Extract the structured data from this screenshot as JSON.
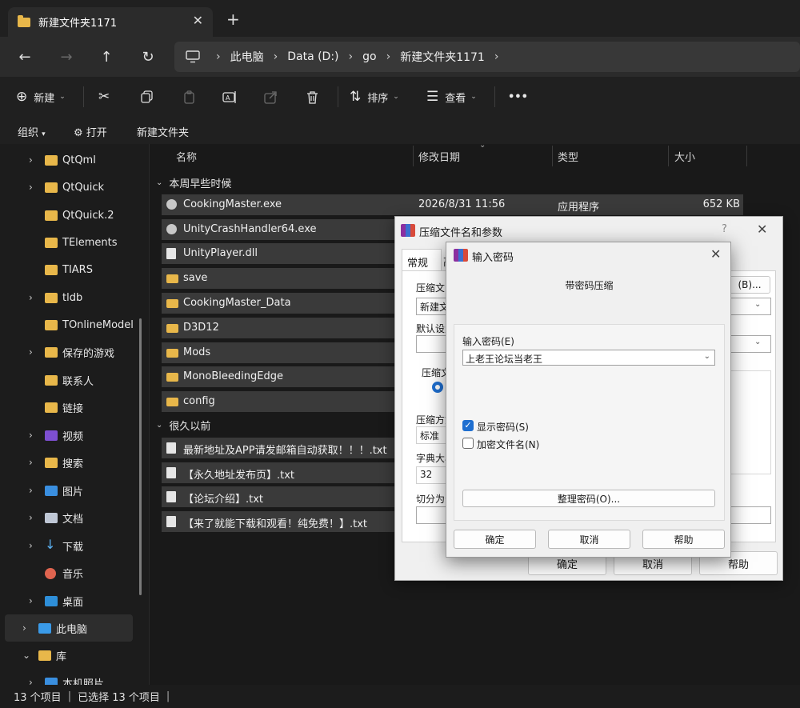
{
  "window": {
    "tab_title": "新建文件夹1171",
    "tab_close": "✕",
    "new_tab": "+"
  },
  "nav": {
    "back": "←",
    "forward": "→",
    "up": "↑",
    "refresh": "↻",
    "breadcrumb": [
      "此电脑",
      "Data (D:)",
      "go",
      "新建文件夹1171"
    ]
  },
  "commandbar": {
    "new_label": "新建",
    "sort_label": "排序",
    "view_label": "查看",
    "more": "•••"
  },
  "subbar": {
    "organize": "组织",
    "open": "打开",
    "new_folder": "新建文件夹"
  },
  "sidebar": {
    "items": [
      {
        "label": "QtQml",
        "icon": "folder-icon",
        "arrow": true
      },
      {
        "label": "QtQuick",
        "icon": "folder-icon",
        "arrow": true
      },
      {
        "label": "QtQuick.2",
        "icon": "folder-icon",
        "arrow": false
      },
      {
        "label": "TElements",
        "icon": "folder-icon",
        "arrow": false
      },
      {
        "label": "TIARS",
        "icon": "folder-icon",
        "arrow": false
      },
      {
        "label": "tldb",
        "icon": "folder-icon",
        "arrow": true
      },
      {
        "label": "TOnlineModel",
        "icon": "folder-icon",
        "arrow": false
      },
      {
        "label": "保存的游戏",
        "icon": "folder-icon",
        "arrow": true
      },
      {
        "label": "联系人",
        "icon": "folder-icon",
        "arrow": false
      },
      {
        "label": "链接",
        "icon": "folder-icon",
        "arrow": false
      },
      {
        "label": "视频",
        "icon": "video-icon",
        "arrow": true
      },
      {
        "label": "搜索",
        "icon": "folder-icon",
        "arrow": true
      },
      {
        "label": "图片",
        "icon": "picture-icon",
        "arrow": true
      },
      {
        "label": "文档",
        "icon": "document-icon",
        "arrow": true
      },
      {
        "label": "下载",
        "icon": "download-icon",
        "arrow": true
      },
      {
        "label": "音乐",
        "icon": "music-icon",
        "arrow": false
      },
      {
        "label": "桌面",
        "icon": "desktop-icon",
        "arrow": true
      },
      {
        "label": "此电脑",
        "icon": "pc-icon",
        "arrow": true
      },
      {
        "label": "库",
        "icon": "folder-icon",
        "arrow": true
      },
      {
        "label": "本机照片",
        "icon": "picture-icon",
        "arrow": true
      }
    ]
  },
  "filelist": {
    "columns": {
      "name": "名称",
      "date": "修改日期",
      "type": "类型",
      "size": "大小"
    },
    "group_recent": "本周早些时候",
    "group_old": "很久以前",
    "recent_rows": [
      {
        "name": "CookingMaster.exe",
        "date": "2026/8/31 11:56",
        "type": "应用程序",
        "size": "652 KB",
        "icon": "exe-icon"
      },
      {
        "name": "UnityCrashHandler64.exe",
        "icon": "exe-icon"
      },
      {
        "name": "UnityPlayer.dll",
        "icon": "dll-icon"
      },
      {
        "name": "save",
        "icon": "folder-icon"
      },
      {
        "name": "CookingMaster_Data",
        "icon": "folder-icon"
      },
      {
        "name": "D3D12",
        "icon": "folder-icon"
      },
      {
        "name": "Mods",
        "icon": "folder-icon"
      },
      {
        "name": "MonoBleedingEdge",
        "icon": "folder-icon"
      },
      {
        "name": "config",
        "icon": "folder-icon"
      }
    ],
    "old_rows": [
      {
        "name": "最新地址及APP请发邮箱自动获取！！！.txt",
        "icon": "text-file-icon"
      },
      {
        "name": "【永久地址发布页】.txt",
        "icon": "text-file-icon"
      },
      {
        "name": "【论坛介绍】.txt",
        "icon": "text-file-icon"
      },
      {
        "name": "【来了就能下载和观看！纯免费！】.txt",
        "icon": "text-file-icon"
      }
    ]
  },
  "status": {
    "count": "13 个项目",
    "selected": "已选择 13 个项目"
  },
  "compress_dialog": {
    "title": "压缩文件名和参数",
    "help_glyph": "?",
    "close_glyph": "✕",
    "tab_general": "常规",
    "tab_advanced": "高",
    "label_archive": "压缩文",
    "archive_value": "新建文",
    "browse_suffix": "(B)...",
    "label_default": "默认设置",
    "label_format": "压缩文",
    "label_method": "压缩方式",
    "method_value": "标准",
    "label_dict": "字典大小",
    "dict_value": "32",
    "label_split": "切分为分",
    "ok": "确定",
    "cancel": "取消",
    "help": "帮助"
  },
  "password_dialog": {
    "title": "输入密码",
    "close_glyph": "✕",
    "heading": "带密码压缩",
    "password_label": "输入密码(E)",
    "password_value": "上老王论坛当老王",
    "show_password": "显示密码(S)",
    "show_password_checked": true,
    "encrypt_names": "加密文件名(N)",
    "encrypt_names_checked": false,
    "organize": "整理密码(O)...",
    "ok": "确定",
    "cancel": "取消",
    "help": "帮助"
  },
  "colors": {
    "accent": "#1f6fd0",
    "folder": "#e8b74a",
    "dark_bg": "#1c1c1c"
  }
}
